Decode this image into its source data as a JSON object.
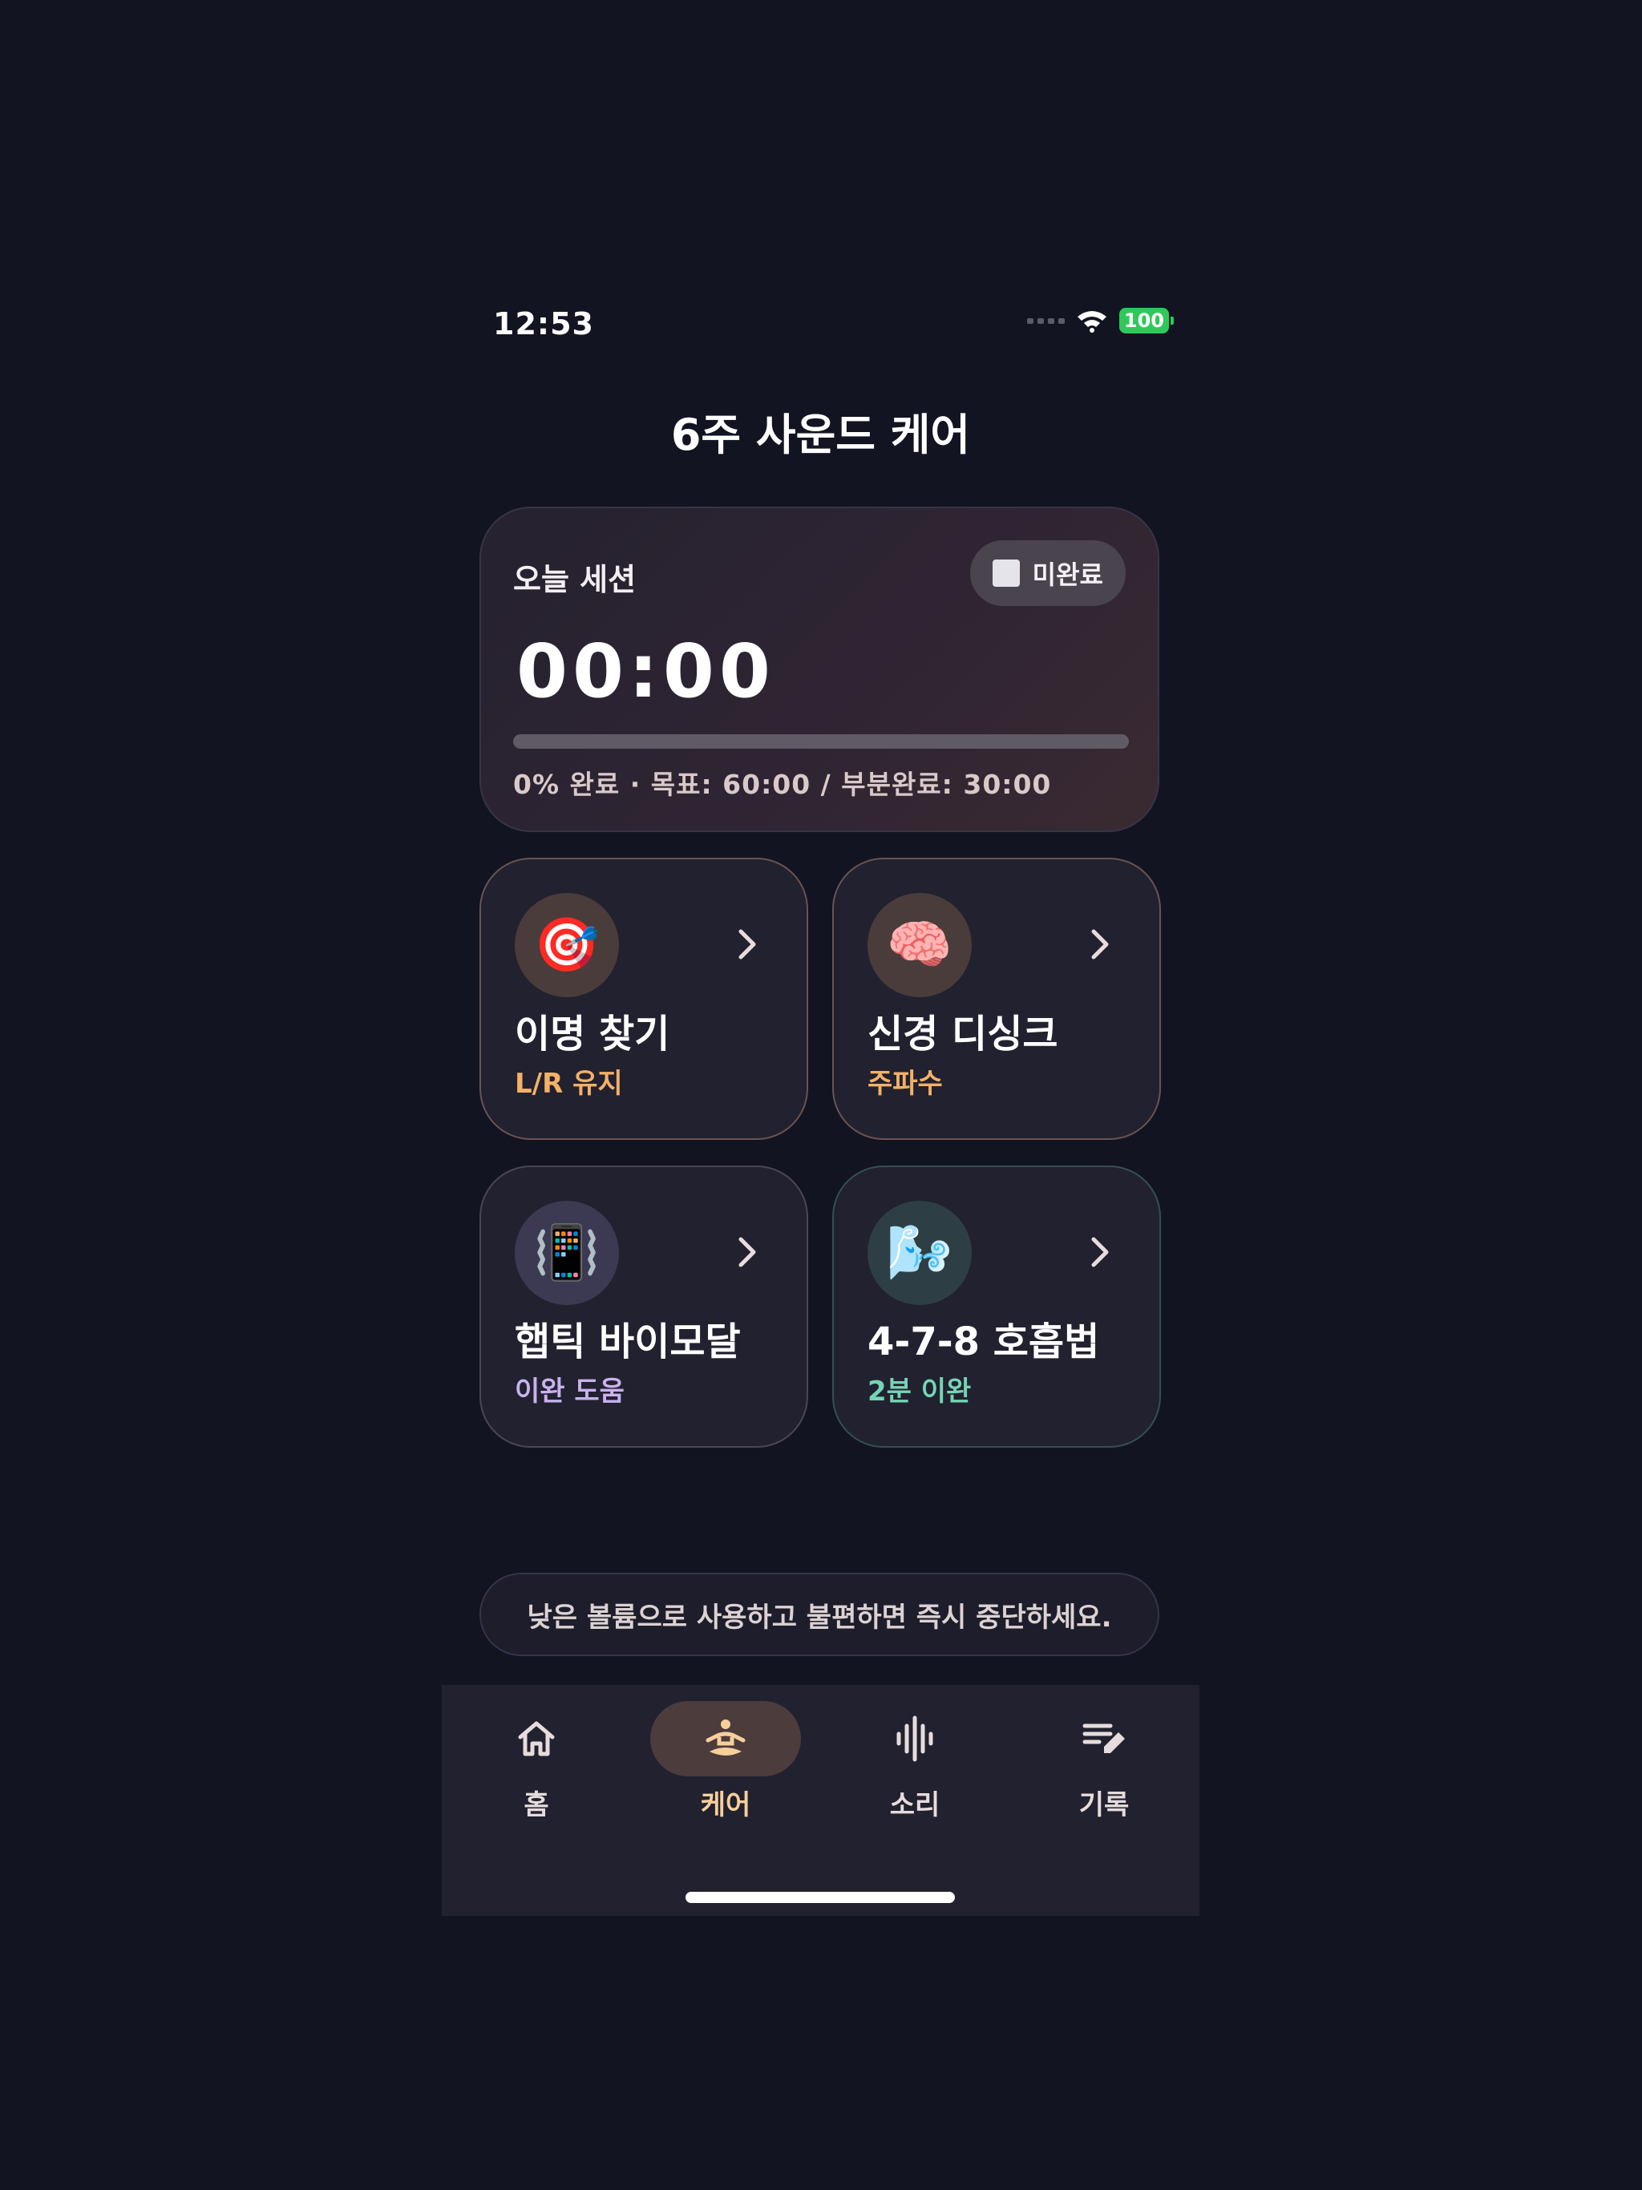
{
  "status_bar": {
    "time": "12:53",
    "battery": "100"
  },
  "page_title": "6주 사운드 케어",
  "session": {
    "label": "오늘 세션",
    "status": "미완료",
    "timer": "00:00",
    "progress": 0,
    "progress_text": "0% 완료 · 목표: 60:00 / 부분완료: 30:00"
  },
  "tiles": [
    {
      "icon": "🎯",
      "icon_name": "dart-target-icon",
      "title": "이명 찾기",
      "subtitle": "L/R 유지",
      "accent": "#f3b168"
    },
    {
      "icon": "🧠",
      "icon_name": "brain-icon",
      "title": "신경 디싱크",
      "subtitle": "주파수",
      "accent": "#f3b168"
    },
    {
      "icon": "📳",
      "icon_name": "vibration-mode-icon",
      "title": "햅틱 바이모달",
      "subtitle": "이완 도움",
      "accent": "#c9b2ee"
    },
    {
      "icon": "🌬️",
      "icon_name": "wind-face-icon",
      "title": "4-7-8 호흡법",
      "subtitle": "2분 이완",
      "accent": "#74d5b4"
    }
  ],
  "notice": "낮은 볼륨으로 사용하고 불편하면 즉시 중단하세요.",
  "tabs": [
    {
      "label": "홈",
      "icon": "home-icon"
    },
    {
      "label": "케어",
      "icon": "meditation-icon"
    },
    {
      "label": "소리",
      "icon": "sound-wave-icon"
    },
    {
      "label": "기록",
      "icon": "edit-note-icon"
    }
  ],
  "colors": {
    "background": "#131422",
    "accent": "#f6cf9c"
  }
}
